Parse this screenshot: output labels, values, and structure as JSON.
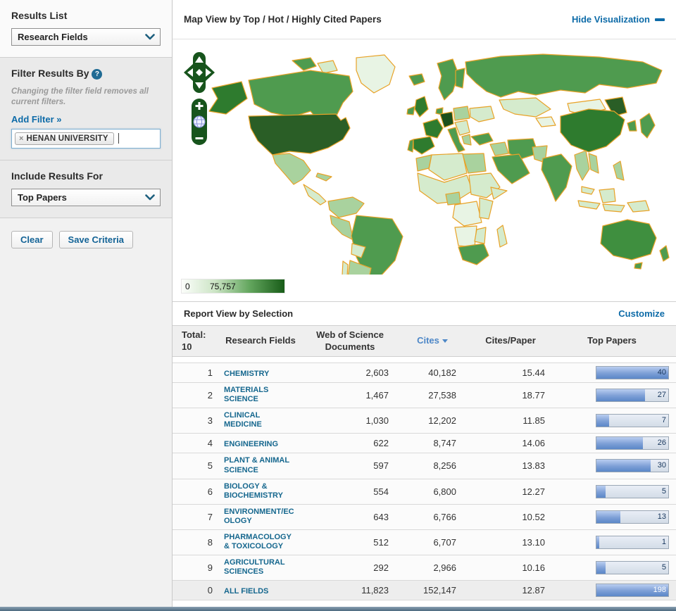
{
  "sidebar": {
    "results_list": {
      "title": "Results List",
      "selected": "Research Fields"
    },
    "filter": {
      "title": "Filter Results By",
      "help_icon": "?",
      "note": "Changing the filter field removes all current filters.",
      "add_filter_label": "Add Filter »",
      "tag": {
        "remove_icon": "×",
        "label": "HENAN UNIVERSITY"
      }
    },
    "include": {
      "title": "Include Results For",
      "selected": "Top Papers"
    },
    "actions": {
      "clear_label": "Clear",
      "save_label": "Save Criteria"
    }
  },
  "map_section": {
    "title": "Map View by Top / Hot / Highly Cited Papers",
    "hide_link": "Hide Visualization",
    "controls": {
      "zoom_in": "+",
      "zoom_out": "−",
      "reset_icon": "globe-icon",
      "pan_icon": "pan-arrows-icon"
    },
    "legend": {
      "min": "0",
      "max": "75,757"
    }
  },
  "report": {
    "title": "Report View by Selection",
    "customize_label": "Customize",
    "columns": {
      "total_label": "Total:",
      "total_count": "10",
      "fields": "Research Fields",
      "wos_documents": "Web of Science Documents",
      "cites": "Cites",
      "cites_per_paper": "Cites/Paper",
      "top_papers": "Top Papers"
    },
    "sorted_by": "Cites",
    "rows": [
      {
        "rank": "1",
        "field": "CHEMISTRY",
        "wos": "2,603",
        "cites": "40,182",
        "cites_per_paper": "15.44",
        "top_papers": "40",
        "bar_percent": 100
      },
      {
        "rank": "2",
        "field": "MATERIALS SCIENCE",
        "wos": "1,467",
        "cites": "27,538",
        "cites_per_paper": "18.77",
        "top_papers": "27",
        "bar_percent": 68
      },
      {
        "rank": "3",
        "field": "CLINICAL MEDICINE",
        "wos": "1,030",
        "cites": "12,202",
        "cites_per_paper": "11.85",
        "top_papers": "7",
        "bar_percent": 18
      },
      {
        "rank": "4",
        "field": "ENGINEERING",
        "wos": "622",
        "cites": "8,747",
        "cites_per_paper": "14.06",
        "top_papers": "26",
        "bar_percent": 65
      },
      {
        "rank": "5",
        "field": "PLANT & ANIMAL SCIENCE",
        "wos": "597",
        "cites": "8,256",
        "cites_per_paper": "13.83",
        "top_papers": "30",
        "bar_percent": 75
      },
      {
        "rank": "6",
        "field": "BIOLOGY & BIOCHEMISTRY",
        "wos": "554",
        "cites": "6,800",
        "cites_per_paper": "12.27",
        "top_papers": "5",
        "bar_percent": 13
      },
      {
        "rank": "7",
        "field": "ENVIRONMENT/ECOLOGY",
        "wos": "643",
        "cites": "6,766",
        "cites_per_paper": "10.52",
        "top_papers": "13",
        "bar_percent": 33
      },
      {
        "rank": "8",
        "field": "PHARMACOLOGY & TOXICOLOGY",
        "wos": "512",
        "cites": "6,707",
        "cites_per_paper": "13.10",
        "top_papers": "1",
        "bar_percent": 4
      },
      {
        "rank": "9",
        "field": "AGRICULTURAL SCIENCES",
        "wos": "292",
        "cites": "2,966",
        "cites_per_paper": "10.16",
        "top_papers": "5",
        "bar_percent": 13
      },
      {
        "rank": "0",
        "field": "ALL FIELDS",
        "wos": "11,823",
        "cites": "152,147",
        "cites_per_paper": "12.87",
        "top_papers": "198",
        "bar_percent": 100
      }
    ]
  },
  "colors": {
    "link_blue": "#0d6ba8",
    "field_link_teal": "#15678e",
    "sorted_column_blue": "#4d87c7",
    "bar_fill_blue": "#6f9ad9",
    "map_border_orange": "#e8a227",
    "map_green_darkest": "#1d4f1d",
    "map_green_dark": "#2a5e26",
    "map_green_mid": "#4f9b4f",
    "map_green_light": "#a9d29e",
    "map_green_pale": "#d5ebcd",
    "map_green_palest": "#e8f4e4",
    "control_green": "#17541c",
    "footer_slate": "#4c697f"
  }
}
